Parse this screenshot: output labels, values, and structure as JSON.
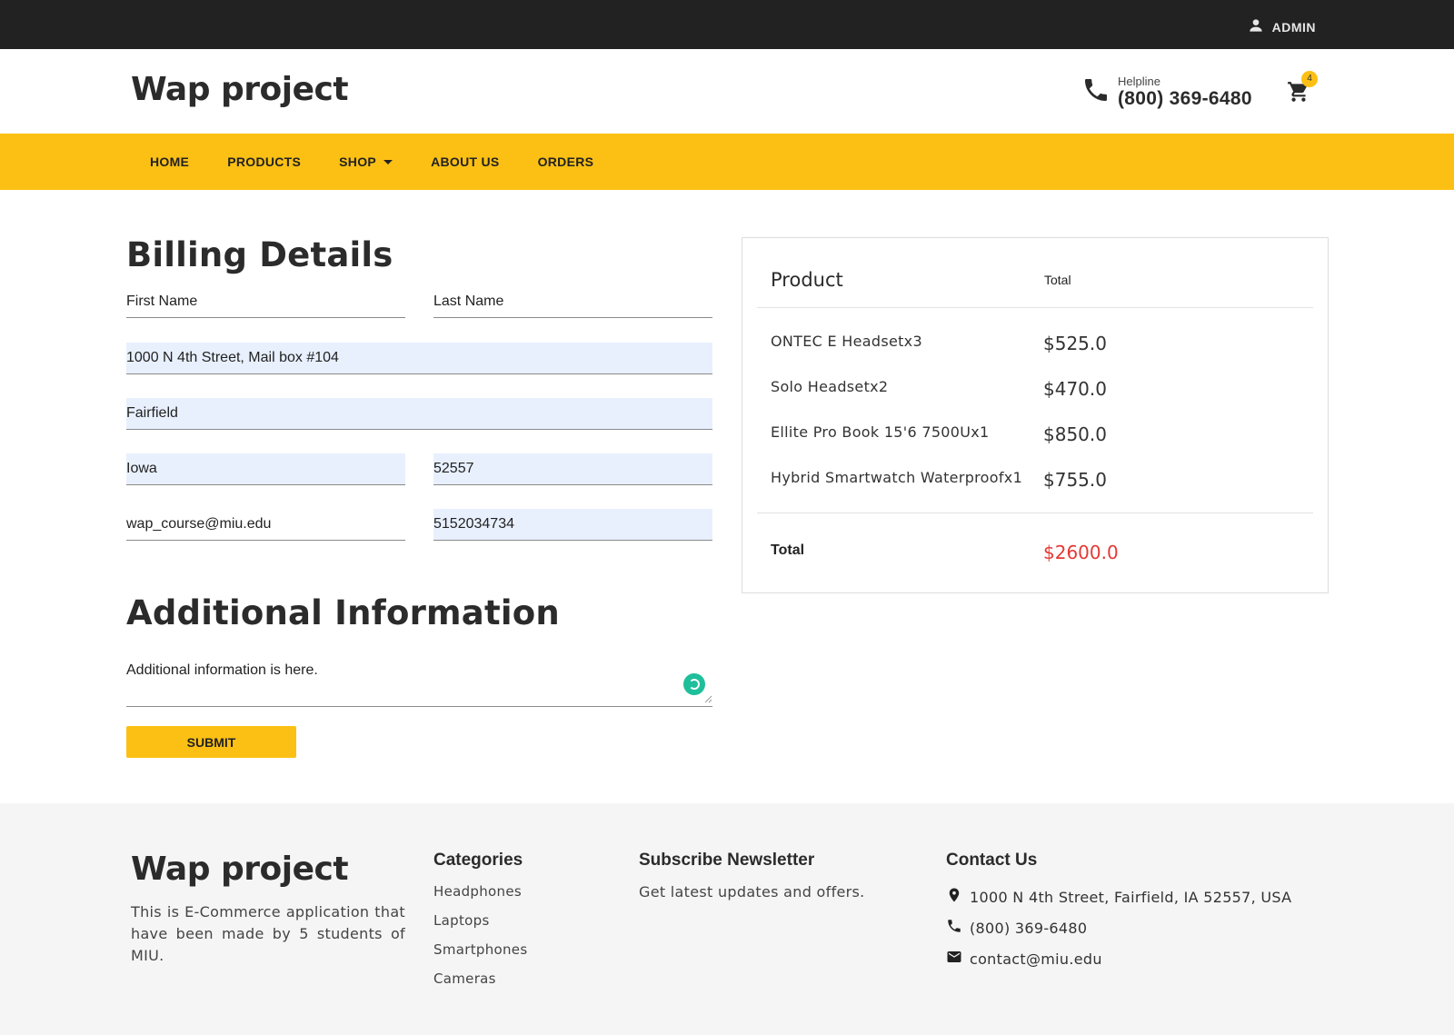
{
  "topbar": {
    "user_label": "ADMIN",
    "user_icon": "person-icon"
  },
  "header": {
    "brand": "Wap project",
    "helpline_label": "Helpline",
    "helpline_phone": "(800) 369-6480",
    "cart_count": "4"
  },
  "nav": {
    "items": [
      {
        "label": "HOME"
      },
      {
        "label": "PRODUCTS"
      },
      {
        "label": "SHOP"
      },
      {
        "label": "ABOUT US"
      },
      {
        "label": "ORDERS"
      }
    ]
  },
  "billing": {
    "title": "Billing Details",
    "first_name_label": "First Name",
    "last_name_label": "Last Name",
    "address": "1000 N 4th Street, Mail box #104",
    "city": "Fairfield",
    "state": "Iowa",
    "zip": "52557",
    "email": "wap_course@miu.edu",
    "phone": "5152034734"
  },
  "additional": {
    "title": "Additional Information",
    "text": "Additional information is here.",
    "submit_label": "SUBMIT"
  },
  "order": {
    "product_header": "Product",
    "total_header": "Total",
    "items": [
      {
        "name": "ONTEC E Headsetx3",
        "price": "$525.0"
      },
      {
        "name": "Solo Headsetx2",
        "price": "$470.0"
      },
      {
        "name": "Ellite Pro Book 15'6 7500Ux1",
        "price": "$850.0"
      },
      {
        "name": "Hybrid Smartwatch Waterproofx1",
        "price": "$755.0"
      }
    ],
    "grand_total_label": "Total",
    "grand_total": "$2600.0",
    "total_color": "#e53935"
  },
  "footer": {
    "brand": "Wap project",
    "description": "This is E-Commerce application that have been made by 5 students of MIU.",
    "categories_title": "Categories",
    "categories": [
      "Headphones",
      "Laptops",
      "Smartphones",
      "Cameras"
    ],
    "newsletter_title": "Subscribe Newsletter",
    "newsletter_text": "Get latest updates and offers.",
    "contact_title": "Contact Us",
    "contact_address": "1000 N 4th Street, Fairfield, IA 52557, USA",
    "contact_phone": "(800) 369-6480",
    "contact_email": "contact@miu.edu"
  },
  "colors": {
    "accent": "#fcc014",
    "topbar": "#222222",
    "autofill": "#e8f0fe",
    "footer_bg": "#f5f5f5"
  }
}
